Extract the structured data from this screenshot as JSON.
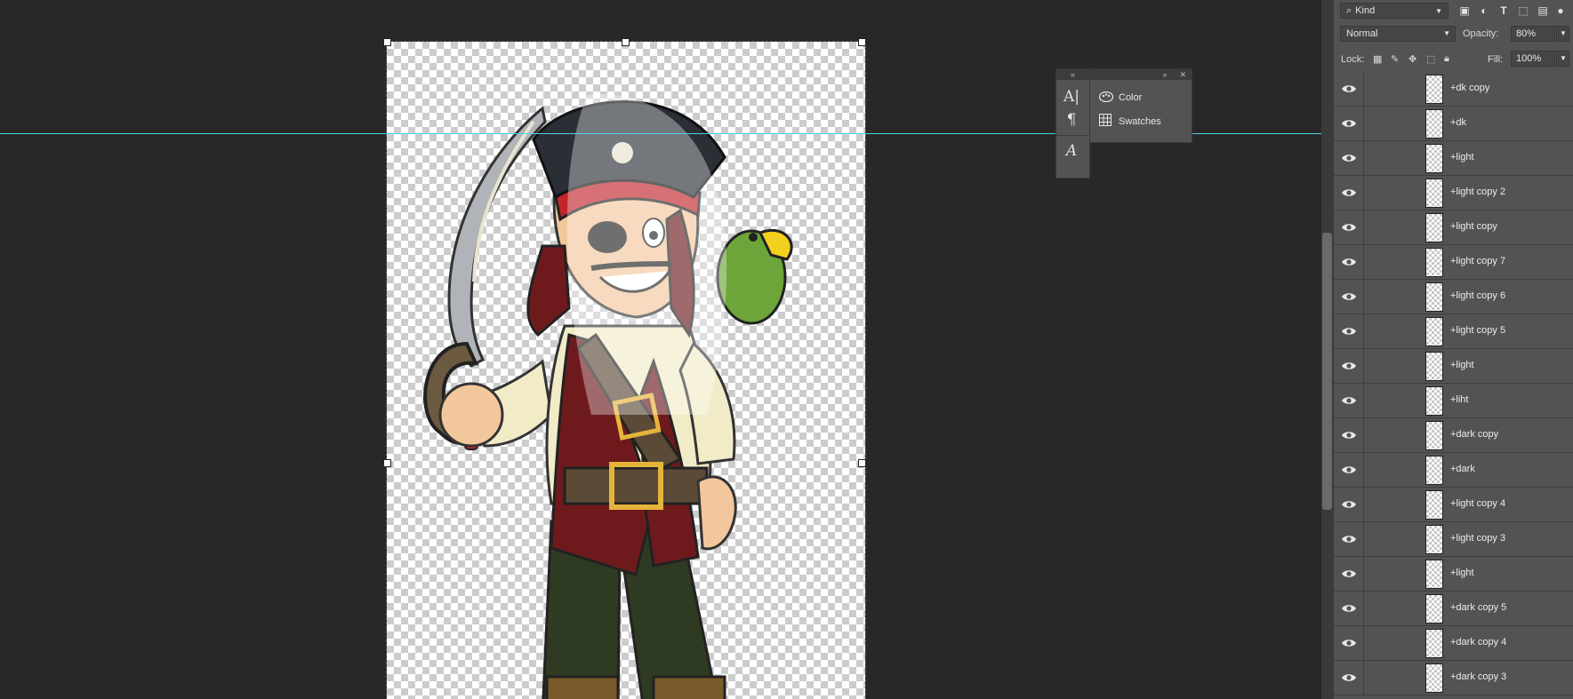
{
  "layers_panel": {
    "filter_kind": "Kind",
    "filter_icons": [
      "image-filter-icon",
      "adjustment-filter-icon",
      "type-filter-icon",
      "shape-filter-icon",
      "smart-object-filter-icon"
    ],
    "blend_mode": "Normal",
    "opacity_label": "Opacity:",
    "opacity_value": "80%",
    "lock_label": "Lock:",
    "fill_label": "Fill:",
    "fill_value": "100%",
    "layers": [
      {
        "name": "+dk copy"
      },
      {
        "name": "+dk"
      },
      {
        "name": "+light"
      },
      {
        "name": "+light copy 2"
      },
      {
        "name": "+light copy"
      },
      {
        "name": "+light copy 7"
      },
      {
        "name": "+light copy 6"
      },
      {
        "name": "+light copy 5"
      },
      {
        "name": "+light"
      },
      {
        "name": "+liht"
      },
      {
        "name": "+dark copy"
      },
      {
        "name": "+dark"
      },
      {
        "name": "+light copy 4"
      },
      {
        "name": "+light copy 3"
      },
      {
        "name": "+light"
      },
      {
        "name": "+dark copy 5"
      },
      {
        "name": "+dark copy 4"
      },
      {
        "name": "+dark copy 3"
      }
    ]
  },
  "floating_panel": {
    "tools": [
      "character-panel-icon",
      "paragraph-panel-icon",
      "glyphs-panel-icon"
    ],
    "items": [
      {
        "label": "Color",
        "icon": "palette-icon"
      },
      {
        "label": "Swatches",
        "icon": "swatches-grid-icon"
      }
    ]
  },
  "colors": {
    "workspace": "#282828",
    "panel": "#535353",
    "guide": "#4fd3e6"
  }
}
